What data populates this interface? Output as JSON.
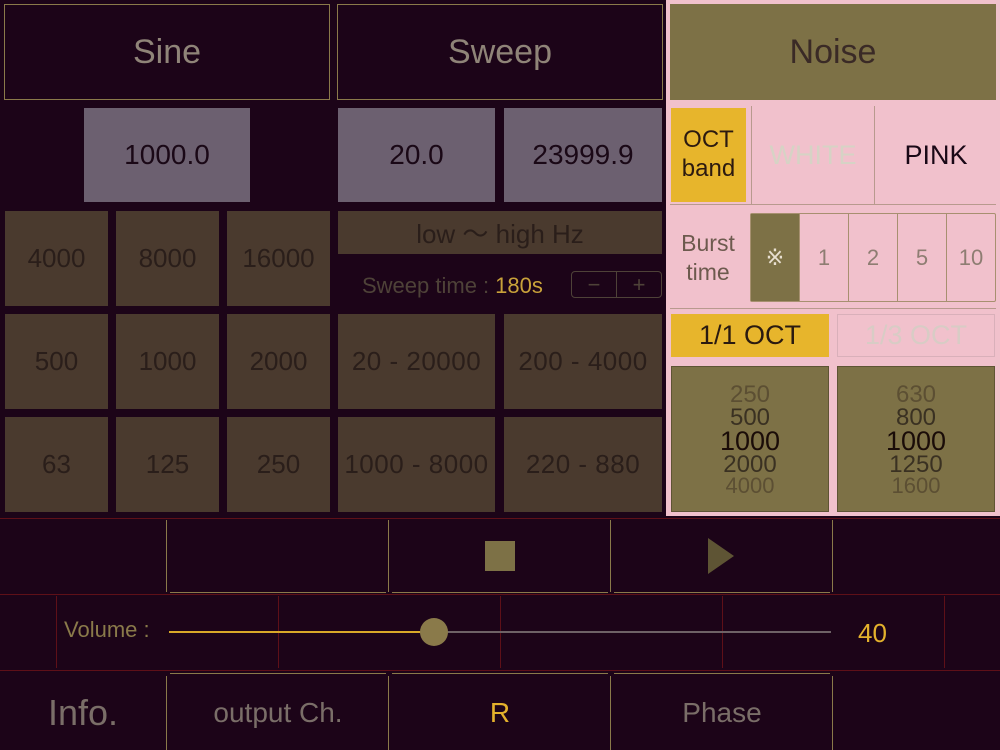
{
  "modes": {
    "sine": "Sine",
    "sweep": "Sweep",
    "noise": "Noise"
  },
  "sine": {
    "frequency": "1000.0",
    "presets": [
      "4000",
      "8000",
      "16000",
      "500",
      "1000",
      "2000",
      "63",
      "125",
      "250"
    ]
  },
  "sweep": {
    "start_freq": "20.0",
    "end_freq": "23999.9",
    "direction_label": "low 〜 high Hz",
    "time_label": "Sweep time :",
    "time_value": "180s",
    "minus": "−",
    "plus": "+",
    "presets": [
      "20 - 20000",
      "200 - 4000",
      "1000 - 8000",
      "220 - 880"
    ]
  },
  "noise": {
    "oct_band": "OCT band",
    "white": "WHITE",
    "pink": "PINK",
    "burst_label": "Burst time",
    "burst_options": [
      "※",
      "1",
      "2",
      "5",
      "10"
    ],
    "oct_1_1": "1/1 OCT",
    "oct_1_3": "1/3 OCT",
    "picker_1_1": [
      "250",
      "500",
      "1000",
      "2000",
      "4000"
    ],
    "picker_1_3": [
      "630",
      "800",
      "1000",
      "1250",
      "1600"
    ]
  },
  "volume": {
    "label": "Volume :",
    "value": "40",
    "level": 0.4
  },
  "footer": {
    "info": "Info.",
    "output": "output Ch.",
    "channel": "R",
    "phase": "Phase"
  },
  "colors": {
    "background": "#1c0418",
    "accent": "#e3b12c",
    "olive": "#7d7146",
    "pink": "#f1c1cc"
  }
}
